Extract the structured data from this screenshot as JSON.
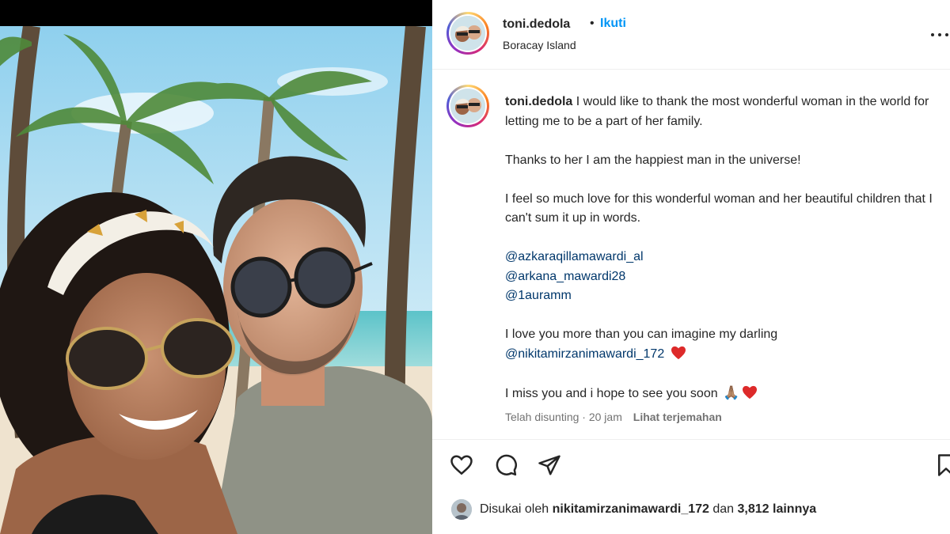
{
  "post": {
    "username": "toni.dedola",
    "separator": "•",
    "follow_label": "Ikuti",
    "location": "Boracay Island"
  },
  "caption": {
    "username": "toni.dedola",
    "line1": "I would like to thank the most wonderful woman in the world for letting me to be a part of her family.",
    "line2": "Thanks to her I am the happiest man in the universe!",
    "line3": "I feel so much love for this wonderful woman and her beautiful children that I can't sum it up in words.",
    "mentions": [
      "@azkaraqillamawardi_al",
      "@arkana_mawardi28",
      "@1auramm"
    ],
    "line4": "I love you more than you can imagine my darling",
    "mention_darling": "@nikitamirzanimawardi_172",
    "line5": "I miss you and i hope to see you soon",
    "pray_emoji": "🙏🏽"
  },
  "meta": {
    "edited": "Telah disunting · 20 jam",
    "see_translation": "Lihat terjemahan"
  },
  "likes": {
    "prefix": "Disukai oleh",
    "user": "nikitamirzanimawardi_172",
    "and": "dan",
    "others": "3,812 lainnya"
  },
  "icons": {
    "like": "heart-outline-icon",
    "comment": "comment-bubble-icon",
    "share": "paper-plane-icon",
    "save": "bookmark-icon",
    "more": "more-horizontal-icon"
  },
  "colors": {
    "follow": "#0095f6",
    "mention": "#00376b",
    "heart": "#ed4956",
    "text": "#262626",
    "muted": "#737373"
  }
}
